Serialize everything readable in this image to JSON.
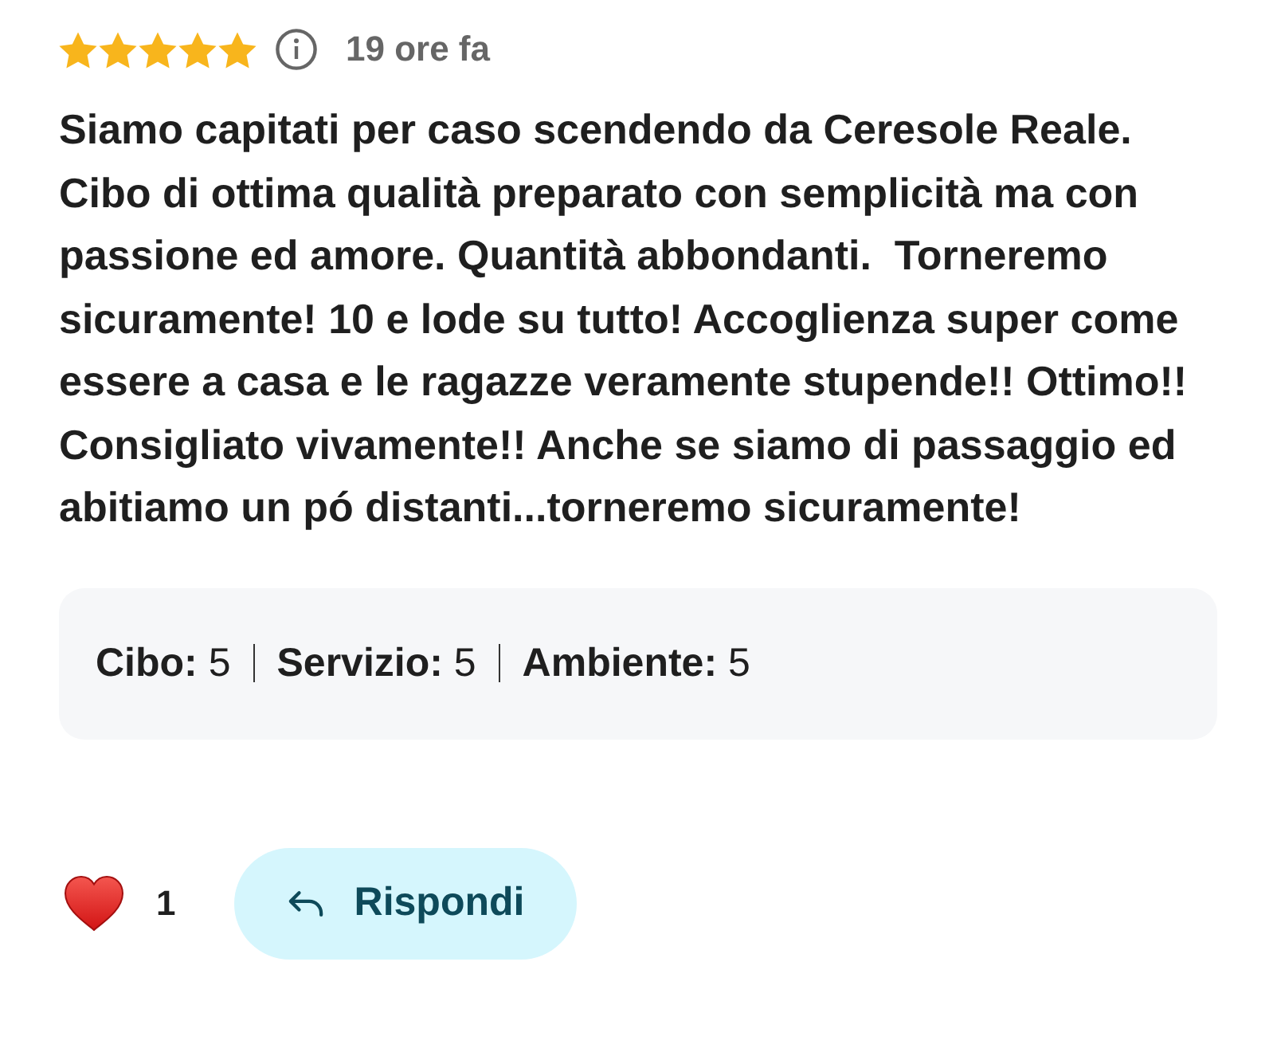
{
  "review": {
    "stars": 5,
    "time": "19 ore fa",
    "text": "Siamo capitati per caso scendendo da Ceresole Reale. Cibo di ottima qualità preparato con semplicità ma con passione ed amore. Quantità abbondanti.  Torneremo sicuramente! 10 e lode su tutto! Accoglienza super come essere a casa e le ragazze veramente stupende!! Ottimo!! Consigliato vivamente!! Anche se siamo di passaggio ed abitiamo un pó distanti...torneremo sicuramente!"
  },
  "ratings": [
    {
      "text": "**Cibo:** 5"
    },
    {
      "text": "**Servizio:** 5"
    },
    {
      "text": "**Ambiente:** 5"
    }
  ],
  "likes": {
    "count": "1"
  },
  "reply_button": {
    "label": "Rispondi"
  }
}
